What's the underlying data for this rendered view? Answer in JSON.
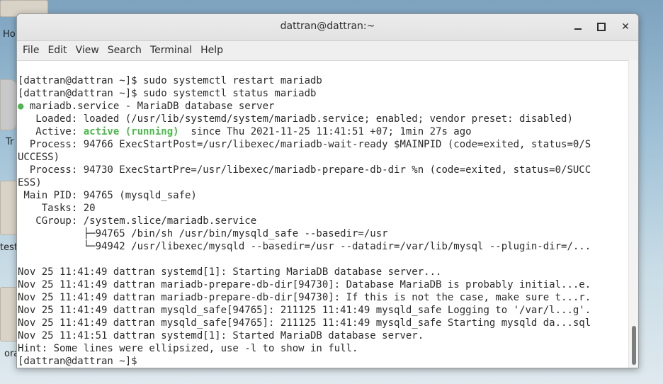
{
  "desktop": {
    "icons": [
      {
        "label": "Ho"
      },
      {
        "label": "Trash"
      },
      {
        "label": "test"
      },
      {
        "label": "ora"
      }
    ],
    "trash_label": "TrUCCESS"
  },
  "window": {
    "title": "dattran@dattran:~",
    "controls": {
      "minimize": "—",
      "maximize": "□",
      "close": "✕"
    }
  },
  "menu": [
    "File",
    "Edit",
    "View",
    "Search",
    "Terminal",
    "Help"
  ],
  "terminal": {
    "lines": [
      "[dattran@dattran ~]$ sudo systemctl restart mariadb",
      "[dattran@dattran ~]$ sudo systemctl status mariadb",
      "mariadb.service - MariaDB database server",
      "   Loaded: loaded (/usr/lib/systemd/system/mariadb.service; enabled; vendor preset: disabled)",
      "  since Thu 2021-11-25 11:41:51 +07; 1min 27s ago",
      "  Process: 94766 ExecStartPost=/usr/libexec/mariadb-wait-ready $MAINPID (code=exited, status=0/S",
      "UCCESS)",
      "  Process: 94730 ExecStartPre=/usr/libexec/mariadb-prepare-db-dir %n (code=exited, status=0/SUCC",
      "ESS)",
      " Main PID: 94765 (mysqld_safe)",
      "    Tasks: 20",
      "   CGroup: /system.slice/mariadb.service",
      "           ├─94765 /bin/sh /usr/bin/mysqld_safe --basedir=/usr",
      "           └─94942 /usr/libexec/mysqld --basedir=/usr --datadir=/var/lib/mysql --plugin-dir=/...",
      "",
      "Nov 25 11:41:49 dattran systemd[1]: Starting MariaDB database server...",
      "Nov 25 11:41:49 dattran mariadb-prepare-db-dir[94730]: Database MariaDB is probably initial...e.",
      "Nov 25 11:41:49 dattran mariadb-prepare-db-dir[94730]: If this is not the case, make sure t...r.",
      "Nov 25 11:41:49 dattran mysqld_safe[94765]: 211125 11:41:49 mysqld_safe Logging to '/var/l...g'.",
      "Nov 25 11:41:49 dattran mysqld_safe[94765]: 211125 11:41:49 mysqld_safe Starting mysqld da...sql",
      "Nov 25 11:41:51 dattran systemd[1]: Started MariaDB database server.",
      "Hint: Some lines were ellipsized, use -l to show in full.",
      "[dattran@dattran ~]$ "
    ],
    "active_prefix": "   Active: ",
    "active_status": "active (running)",
    "status_dot": "●",
    "status_color": "#4eb84e"
  }
}
